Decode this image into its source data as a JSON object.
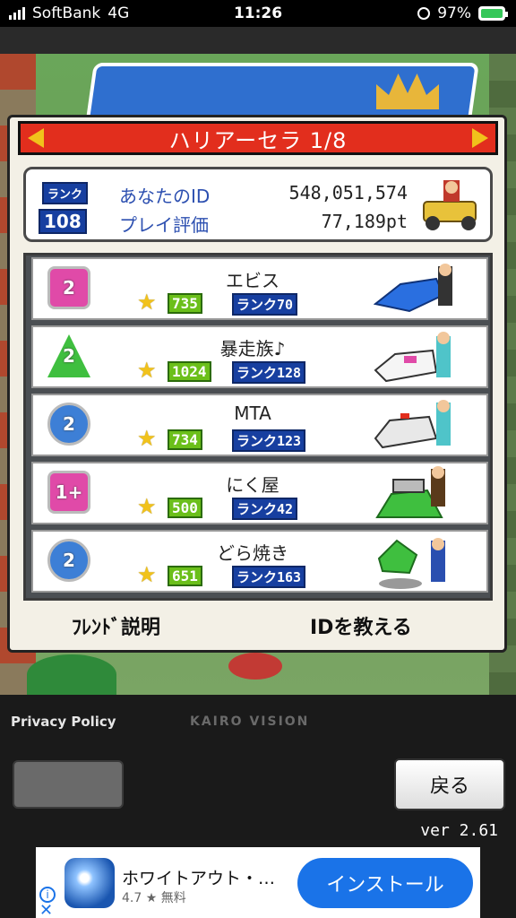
{
  "status_bar": {
    "carrier": "SoftBank",
    "network": "4G",
    "time": "11:26",
    "battery": "97%"
  },
  "header": {
    "title": "ハリアーセラ 1/8"
  },
  "my_info": {
    "rank_tag": "ランク",
    "rank_value": "108",
    "id_label": "あなたのID",
    "id_value": "548,051,574",
    "play_label": "プレイ評価",
    "play_value": "77,189pt"
  },
  "friends": [
    {
      "badge": "2",
      "badge_shape": "square",
      "badge_color": "#e04aa8",
      "name": "エビス",
      "rating": "735",
      "rank": "ランク70"
    },
    {
      "badge": "2",
      "badge_shape": "triangle",
      "badge_color": "#3fbf3f",
      "name": "暴走族♪",
      "rating": "1024",
      "rank": "ランク128"
    },
    {
      "badge": "2",
      "badge_shape": "circle",
      "badge_color": "#3d7fd6",
      "name": "MTA",
      "rating": "734",
      "rank": "ランク123"
    },
    {
      "badge": "1+",
      "badge_shape": "square",
      "badge_color": "#e04aa8",
      "name": "にく屋",
      "rating": "500",
      "rank": "ランク42"
    },
    {
      "badge": "2",
      "badge_shape": "circle",
      "badge_color": "#3d7fd6",
      "name": "どら焼き",
      "rating": "651",
      "rank": "ランク163"
    }
  ],
  "actions": {
    "friend_explain": "ﾌﾚﾝﾄﾞ説明",
    "tell_id": "IDを教える"
  },
  "footer": {
    "privacy": "Privacy Policy",
    "brand": "KAIRO VISION",
    "back": "戻る",
    "version": "ver 2.61"
  },
  "ad": {
    "title": "ホワイトアウト・…",
    "rating": "4.7 ★ 無料",
    "install": "インストール"
  }
}
